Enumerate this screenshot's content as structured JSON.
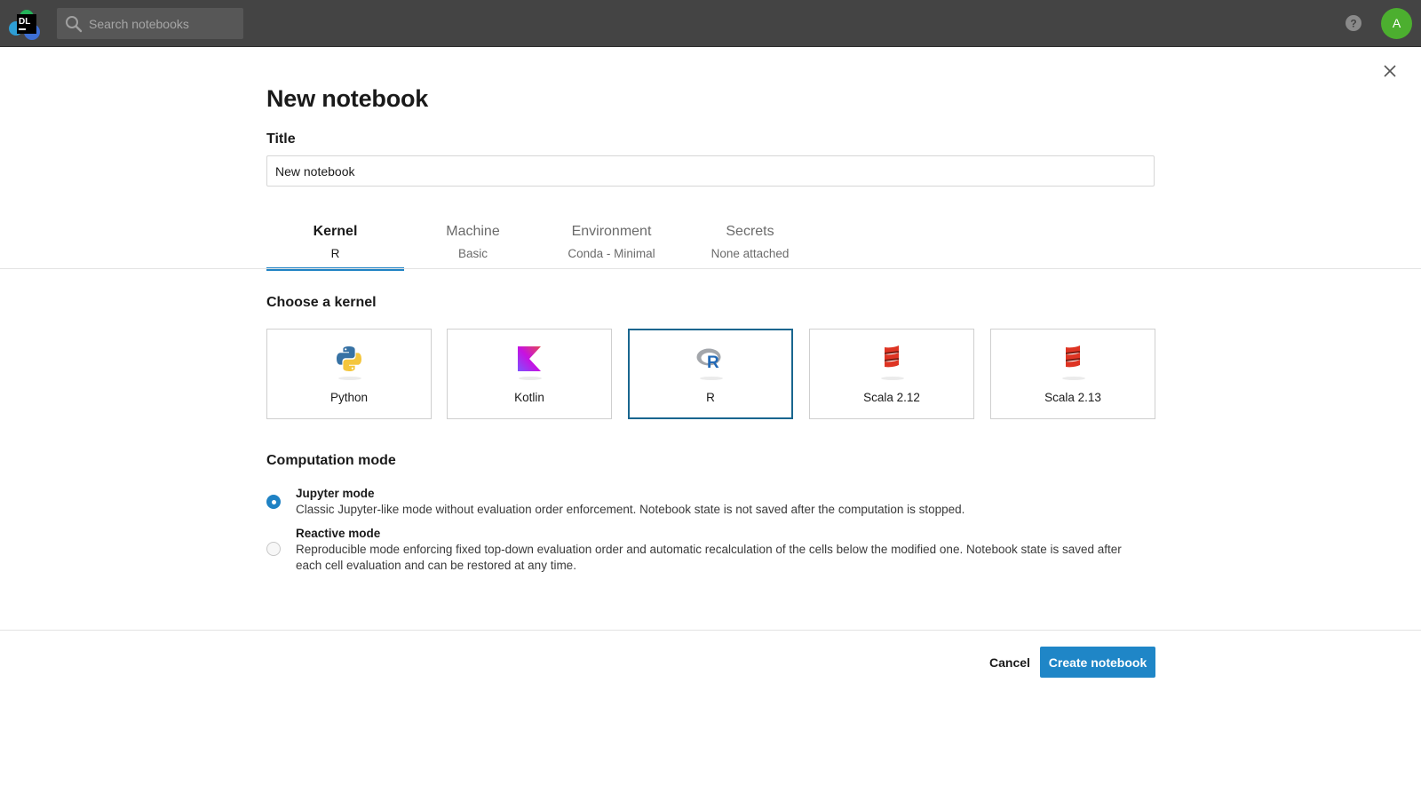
{
  "header": {
    "logo_text": "DL",
    "search": {
      "placeholder": "Search notebooks",
      "value": ""
    },
    "avatar_initial": "A",
    "help_icon": "question-circle-icon"
  },
  "dialog": {
    "title": "New notebook",
    "title_label": "Title",
    "title_value": "New notebook",
    "tabs": [
      {
        "label": "Kernel",
        "sub": "R",
        "active": true
      },
      {
        "label": "Machine",
        "sub": "Basic",
        "active": false
      },
      {
        "label": "Environment",
        "sub": "Conda - Minimal",
        "active": false
      },
      {
        "label": "Secrets",
        "sub": "None attached",
        "active": false
      }
    ],
    "kernel_heading": "Choose a kernel",
    "kernels": [
      {
        "name": "Python",
        "icon": "python-icon",
        "selected": false
      },
      {
        "name": "Kotlin",
        "icon": "kotlin-icon",
        "selected": false
      },
      {
        "name": "R",
        "icon": "r-icon",
        "selected": true
      },
      {
        "name": "Scala 2.12",
        "icon": "scala-icon",
        "selected": false
      },
      {
        "name": "Scala 2.13",
        "icon": "scala-icon",
        "selected": false
      }
    ],
    "computation_heading": "Computation mode",
    "modes": [
      {
        "title": "Jupyter mode",
        "description": "Classic Jupyter-like mode without evaluation order enforcement. Notebook state is not saved after the computation is stopped.",
        "selected": true
      },
      {
        "title": "Reactive mode",
        "description": "Reproducible mode enforcing fixed top-down evaluation order and automatic recalculation of the cells below the modified one. Notebook state is saved after each cell evaluation and can be restored at any time.",
        "selected": false
      }
    ],
    "cancel_label": "Cancel",
    "create_label": "Create notebook"
  },
  "colors": {
    "topbar": "#444444",
    "accent": "#1f82c4",
    "selected_border": "#19668f",
    "avatar": "#4caf2f"
  }
}
